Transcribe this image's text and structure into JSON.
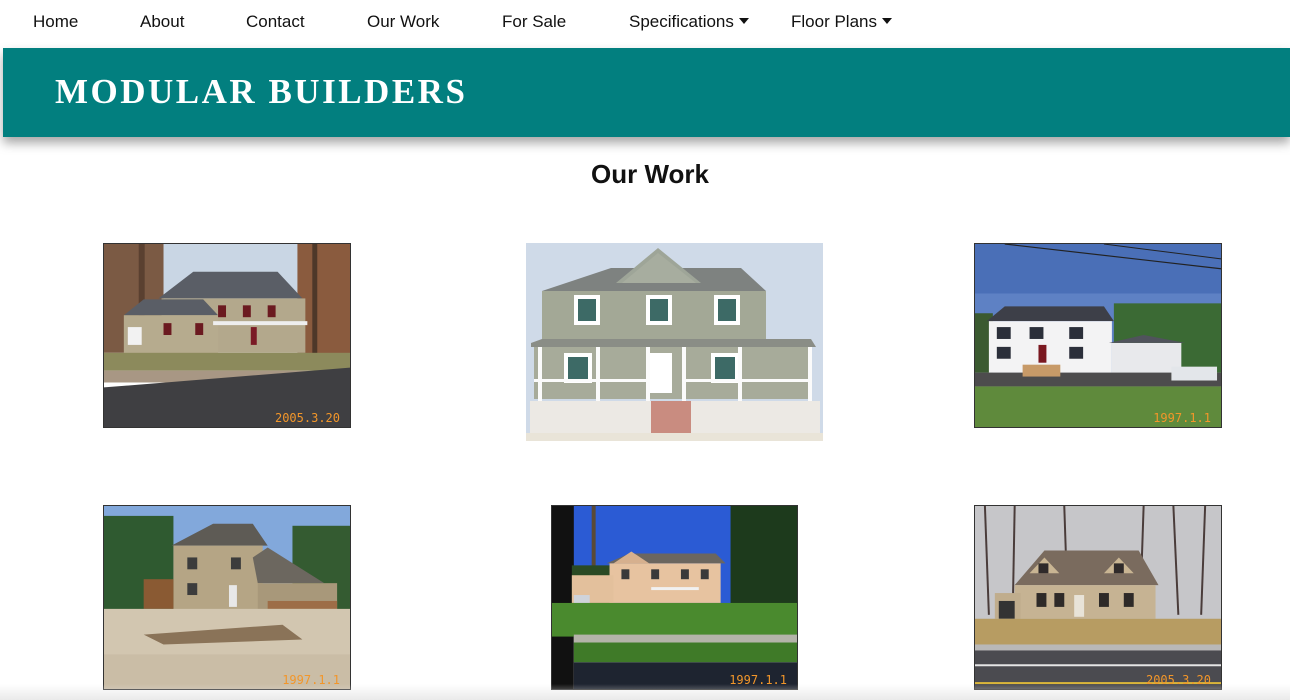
{
  "nav": {
    "items": [
      {
        "label": "Home"
      },
      {
        "label": "About"
      },
      {
        "label": "Contact"
      },
      {
        "label": "Our Work"
      },
      {
        "label": "For Sale"
      },
      {
        "label": "Specifications",
        "has_dropdown": true
      },
      {
        "label": "Floor Plans",
        "has_dropdown": true
      }
    ]
  },
  "banner": {
    "title": "MODULAR BUILDERS",
    "color": "#027f7f"
  },
  "main": {
    "heading": "Our Work",
    "photos": [
      {
        "stamp": "2005.3.20"
      },
      {
        "stamp": ""
      },
      {
        "stamp": "1997.1.1"
      },
      {
        "stamp": "1997.1.1"
      },
      {
        "stamp": "1997.1.1"
      },
      {
        "stamp": "2005.3.20"
      }
    ]
  }
}
